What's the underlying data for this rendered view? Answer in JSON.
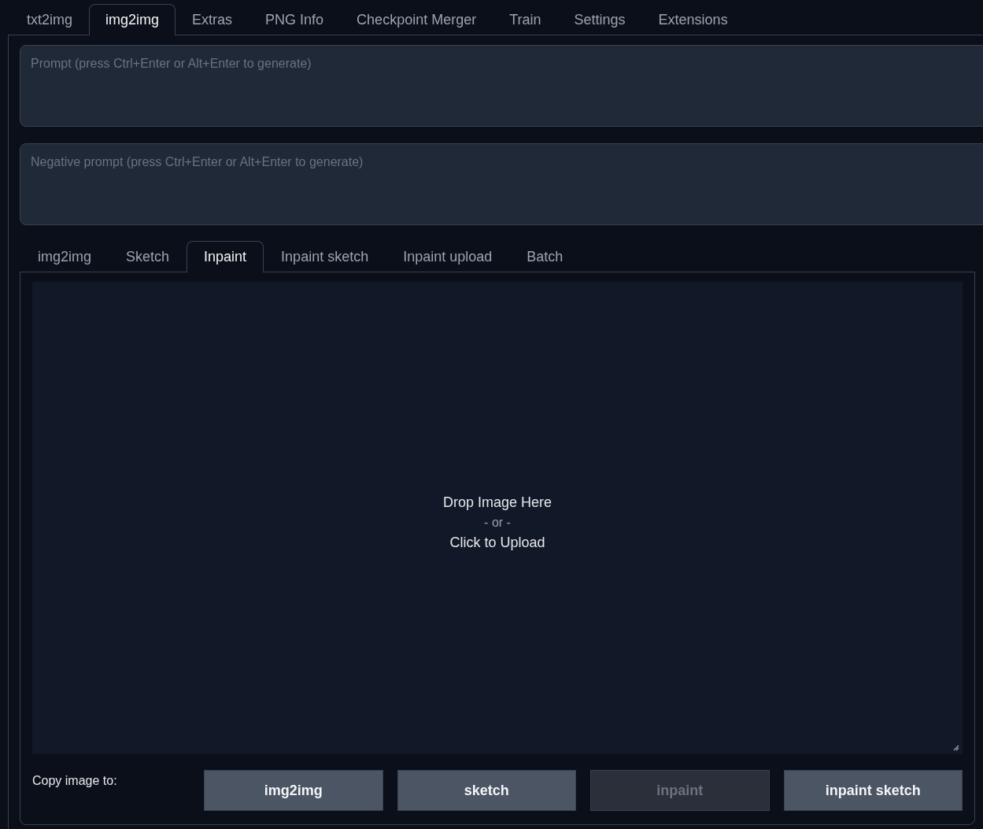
{
  "tabs": [
    {
      "label": "txt2img",
      "selected": false
    },
    {
      "label": "img2img",
      "selected": true
    },
    {
      "label": "Extras",
      "selected": false
    },
    {
      "label": "PNG Info",
      "selected": false
    },
    {
      "label": "Checkpoint Merger",
      "selected": false
    },
    {
      "label": "Train",
      "selected": false
    },
    {
      "label": "Settings",
      "selected": false
    },
    {
      "label": "Extensions",
      "selected": false
    }
  ],
  "prompt": {
    "placeholder": "Prompt (press Ctrl+Enter or Alt+Enter to generate)"
  },
  "negative_prompt": {
    "placeholder": "Negative prompt (press Ctrl+Enter or Alt+Enter to generate)"
  },
  "sub_tabs": [
    {
      "label": "img2img",
      "selected": false
    },
    {
      "label": "Sketch",
      "selected": false
    },
    {
      "label": "Inpaint",
      "selected": true
    },
    {
      "label": "Inpaint sketch",
      "selected": false
    },
    {
      "label": "Inpaint upload",
      "selected": false
    },
    {
      "label": "Batch",
      "selected": false
    }
  ],
  "upload": {
    "drop_text": "Drop Image Here",
    "or_text": "- or -",
    "click_text": "Click to Upload"
  },
  "copy_label": "Copy image to:",
  "copy_buttons": [
    {
      "label": "img2img",
      "disabled": false
    },
    {
      "label": "sketch",
      "disabled": false
    },
    {
      "label": "inpaint",
      "disabled": true
    },
    {
      "label": "inpaint sketch",
      "disabled": false
    }
  ]
}
